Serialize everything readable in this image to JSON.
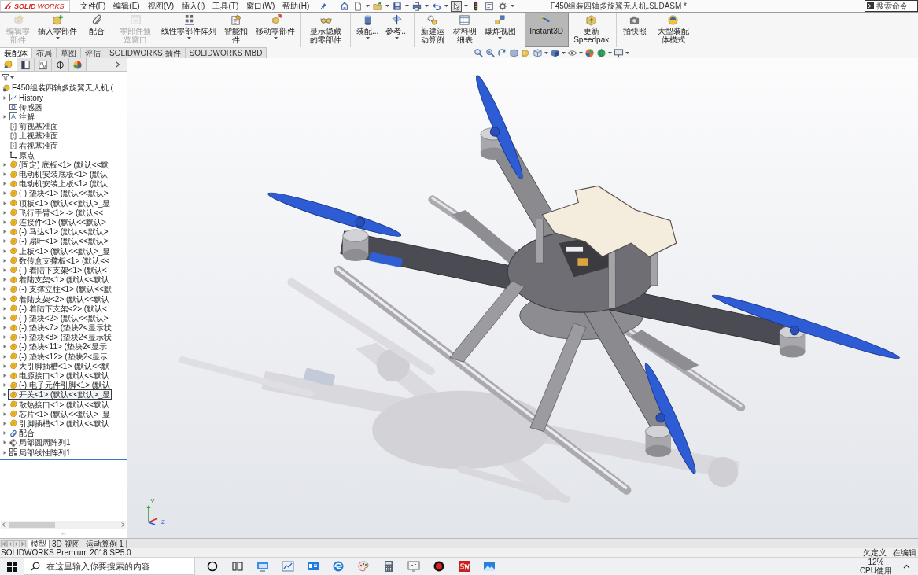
{
  "title_bar": {
    "logo": "**SOLID**WORKS",
    "menus": [
      "文件(F)",
      "编辑(E)",
      "视图(V)",
      "插入(I)",
      "工具(T)",
      "窗口(W)",
      "帮助(H)"
    ],
    "quick_access": [
      {
        "kind": "home",
        "dropdown": false,
        "pressed": false
      },
      {
        "kind": "new",
        "dropdown": true,
        "pressed": false
      },
      {
        "kind": "open",
        "dropdown": true,
        "pressed": false
      },
      {
        "kind": "save",
        "dropdown": true,
        "pressed": false
      },
      {
        "kind": "print",
        "dropdown": true,
        "pressed": false
      },
      {
        "kind": "undo",
        "dropdown": true,
        "pressed": false
      },
      {
        "kind": "select",
        "dropdown": true,
        "pressed": true
      },
      {
        "kind": "rebuild",
        "dropdown": false,
        "pressed": false
      },
      {
        "kind": "file-properties",
        "dropdown": false,
        "pressed": false
      },
      {
        "kind": "options",
        "dropdown": true,
        "pressed": false
      }
    ],
    "document_title": "F450组装四轴多旋翼无人机.SLDASM *",
    "search": {
      "placeholder": "搜索命令"
    }
  },
  "command_groups": [
    [
      {
        "label": "编辑零部件",
        "kind": "edit-component",
        "dropdown": false,
        "disabled": true,
        "pressed": false
      },
      {
        "label": "插入零部件",
        "kind": "insert-component",
        "dropdown": true,
        "disabled": false,
        "pressed": false
      },
      {
        "label": "配合",
        "kind": "mate",
        "dropdown": false,
        "disabled": false,
        "pressed": false
      },
      {
        "label": "零部件预览窗口",
        "kind": "preview-window",
        "dropdown": false,
        "disabled": true,
        "pressed": false
      },
      {
        "label": "线性零部件阵列",
        "kind": "linear-pattern",
        "dropdown": true,
        "disabled": false,
        "pressed": false
      },
      {
        "label": "智能扣件",
        "kind": "smart-fastener",
        "dropdown": false,
        "disabled": false,
        "pressed": false
      },
      {
        "label": "移动零部件",
        "kind": "move-component",
        "dropdown": true,
        "disabled": false,
        "pressed": false
      }
    ],
    [
      {
        "label": "显示隐藏的零部件",
        "kind": "show-hidden",
        "dropdown": false,
        "disabled": false,
        "pressed": false
      }
    ],
    [
      {
        "label": "装配...",
        "kind": "assembly-features",
        "dropdown": true,
        "disabled": false,
        "pressed": false
      },
      {
        "label": "参考...",
        "kind": "reference-geometry",
        "dropdown": true,
        "disabled": false,
        "pressed": false
      }
    ],
    [
      {
        "label": "新建运动算例",
        "kind": "motion-study",
        "dropdown": false,
        "disabled": false,
        "pressed": false
      },
      {
        "label": "材料明细表",
        "kind": "bom",
        "dropdown": false,
        "disabled": false,
        "pressed": false
      },
      {
        "label": "爆炸视图",
        "kind": "exploded-view",
        "dropdown": true,
        "disabled": false,
        "pressed": false
      }
    ],
    [
      {
        "label": "Instant3D",
        "kind": "instant3d",
        "dropdown": false,
        "disabled": false,
        "pressed": true
      },
      {
        "label": "更新 Speedpak",
        "kind": "speedpak",
        "dropdown": false,
        "disabled": false,
        "pressed": false
      }
    ],
    [
      {
        "label": "拍快照",
        "kind": "snapshot",
        "dropdown": false,
        "disabled": false,
        "pressed": false
      },
      {
        "label": "大型装配体模式",
        "kind": "large-assembly",
        "dropdown": false,
        "disabled": false,
        "pressed": false
      }
    ]
  ],
  "ribbon_tabs": [
    {
      "label": "装配体",
      "selected": true
    },
    {
      "label": "布局",
      "selected": false
    },
    {
      "label": "草图",
      "selected": false
    },
    {
      "label": "评估",
      "selected": false
    },
    {
      "label": "SOLIDWORKS 插件",
      "selected": false
    },
    {
      "label": "SOLIDWORKS MBD",
      "selected": false
    }
  ],
  "panel_tabs": [
    {
      "kind": "feature-manager",
      "selected": true
    },
    {
      "kind": "property-manager",
      "selected": false
    },
    {
      "kind": "configuration-manager",
      "selected": false
    },
    {
      "kind": "dimxpert",
      "selected": false
    },
    {
      "kind": "display-manager",
      "selected": false
    }
  ],
  "feature_tree": {
    "root": {
      "label": "F450组装四轴多旋翼无人机 (",
      "kind": "assembly",
      "selected": false,
      "children": [
        {
          "label": "History",
          "kind": "history",
          "expandable": true,
          "selected": false
        },
        {
          "label": "传感器",
          "kind": "sensor",
          "expandable": false,
          "selected": false
        },
        {
          "label": "注解",
          "kind": "annotation",
          "expandable": true,
          "selected": false
        },
        {
          "label": "前视基准面",
          "kind": "plane",
          "expandable": false,
          "selected": false
        },
        {
          "label": "上视基准面",
          "kind": "plane",
          "expandable": false,
          "selected": false
        },
        {
          "label": "右视基准面",
          "kind": "plane",
          "expandable": false,
          "selected": false
        },
        {
          "label": "原点",
          "kind": "origin",
          "expandable": false,
          "selected": false
        },
        {
          "label": "(固定) 底板<1> (默认<<默",
          "kind": "part",
          "expandable": true,
          "selected": false
        },
        {
          "label": "电动机安装底板<1> (默认",
          "kind": "part",
          "expandable": true,
          "selected": false
        },
        {
          "label": "电动机安装上板<1> (默认",
          "kind": "part",
          "expandable": true,
          "selected": false
        },
        {
          "label": "(-) 垫块<1> (默认<<默认>",
          "kind": "part",
          "expandable": true,
          "selected": false
        },
        {
          "label": "顶板<1> (默认<<默认>_显",
          "kind": "part",
          "expandable": true,
          "selected": false
        },
        {
          "label": "飞行手臂<1> -> (默认<<",
          "kind": "part",
          "expandable": true,
          "selected": false
        },
        {
          "label": "连接件<1> (默认<<默认>",
          "kind": "part",
          "expandable": true,
          "selected": false
        },
        {
          "label": "(-) 马达<1> (默认<<默认>",
          "kind": "part",
          "expandable": true,
          "selected": false
        },
        {
          "label": "(-) 扇叶<1> (默认<<默认>",
          "kind": "part",
          "expandable": true,
          "selected": false
        },
        {
          "label": "上板<1> (默认<<默认>_显",
          "kind": "part",
          "expandable": true,
          "selected": false
        },
        {
          "label": "数传盒支撑板<1> (默认<<",
          "kind": "part",
          "expandable": true,
          "selected": false
        },
        {
          "label": "(-) 着陆下支架<1> (默认<",
          "kind": "part",
          "expandable": true,
          "selected": false
        },
        {
          "label": "着陆支架<1> (默认<<默认",
          "kind": "part",
          "expandable": true,
          "selected": false
        },
        {
          "label": "(-) 支撑立柱<1> (默认<<默",
          "kind": "part",
          "expandable": true,
          "selected": false
        },
        {
          "label": "着陆支架<2> (默认<<默认",
          "kind": "part",
          "expandable": true,
          "selected": false
        },
        {
          "label": "(-) 着陆下支架<2> (默认<",
          "kind": "part",
          "expandable": true,
          "selected": false
        },
        {
          "label": "(-) 垫块<2> (默认<<默认>",
          "kind": "part",
          "expandable": true,
          "selected": false
        },
        {
          "label": "(-) 垫块<7> (垫块2<显示状",
          "kind": "part",
          "expandable": true,
          "selected": false
        },
        {
          "label": "(-) 垫块<8> (垫块2<显示状",
          "kind": "part",
          "expandable": true,
          "selected": false
        },
        {
          "label": "(-) 垫块<11> (垫块2<显示",
          "kind": "part",
          "expandable": true,
          "selected": false
        },
        {
          "label": "(-) 垫块<12> (垫块2<显示",
          "kind": "part",
          "expandable": true,
          "selected": false
        },
        {
          "label": "大引脚插槽<1> (默认<<默",
          "kind": "part",
          "expandable": true,
          "selected": false
        },
        {
          "label": "电源接口<1> (默认<<默认",
          "kind": "part",
          "expandable": true,
          "selected": false
        },
        {
          "label": "(-) 电子元件引脚<1> (默认",
          "kind": "part",
          "expandable": true,
          "selected": false
        },
        {
          "label": "开关<1> (默认<<默认>_显",
          "kind": "part",
          "expandable": true,
          "selected": true
        },
        {
          "label": "散热接口<1> (默认<<默认",
          "kind": "part",
          "expandable": true,
          "selected": false
        },
        {
          "label": "芯片<1> (默认<<默认>_显",
          "kind": "part",
          "expandable": true,
          "selected": false
        },
        {
          "label": "引脚插槽<1> (默认<<默认",
          "kind": "part",
          "expandable": true,
          "selected": false
        },
        {
          "label": "配合",
          "kind": "mates",
          "expandable": true,
          "selected": false
        },
        {
          "label": "局部圆周阵列1",
          "kind": "circular-pattern",
          "expandable": true,
          "selected": false
        },
        {
          "label": "局部线性阵列1",
          "kind": "linear-pattern",
          "expandable": true,
          "selected": false
        }
      ]
    }
  },
  "view_triad": {
    "y_label": "Y",
    "z_label": "Z"
  },
  "sheet_tabs": [
    {
      "label": "模型",
      "selected": true
    },
    {
      "label": "3D 视图",
      "selected": false
    },
    {
      "label": "运动算例 1",
      "selected": false
    }
  ],
  "status_bar": {
    "product": "SOLIDWORKS Premium 2018 SP5.0",
    "definition": "欠定义",
    "mode": "在编辑"
  },
  "taskbar": {
    "search": {
      "placeholder": "在这里输入你要搜索的内容"
    },
    "cpu": {
      "value": "12%",
      "label": "CPU使用"
    }
  }
}
